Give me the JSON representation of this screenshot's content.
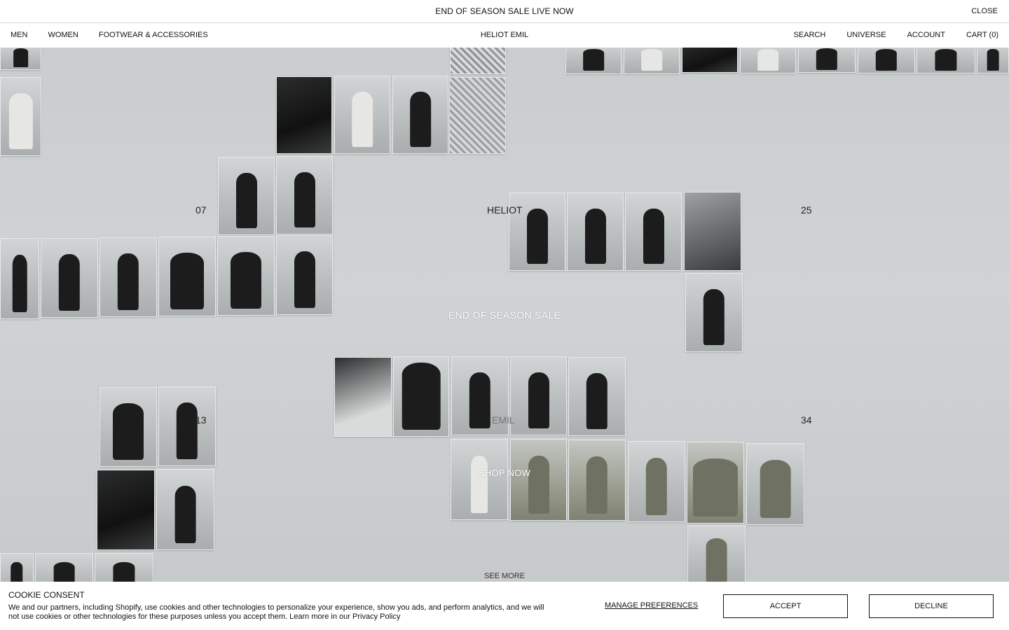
{
  "announcement": {
    "text": "END OF SEASON SALE LIVE NOW",
    "close_label": "CLOSE"
  },
  "header": {
    "nav_left": [
      "MEN",
      "WOMEN",
      "FOOTWEAR & ACCESSORIES"
    ],
    "logo": "HELIOT EMIL",
    "nav_right": [
      "SEARCH",
      "UNIVERSE",
      "ACCOUNT",
      "CART (0)"
    ]
  },
  "hero": {
    "labels": {
      "n07": "07",
      "heliot": "HELIOT",
      "n25": "25",
      "n13": "13",
      "emil": "EMIL",
      "n34": "34"
    },
    "title": "END OF SEASON SALE",
    "cta": "SHOP NOW",
    "see_more": "SEE MORE"
  },
  "cookie": {
    "title": "COOKIE CONSENT",
    "body": "We and our partners, including Shopify, use cookies and other technologies to personalize your experience, show you ads, and perform analytics, and we will not use cookies or other technologies for these purposes unless you accept them. Learn more in our Privacy Policy",
    "manage": "MANAGE PREFERENCES",
    "accept": "ACCEPT",
    "decline": "DECLINE"
  }
}
